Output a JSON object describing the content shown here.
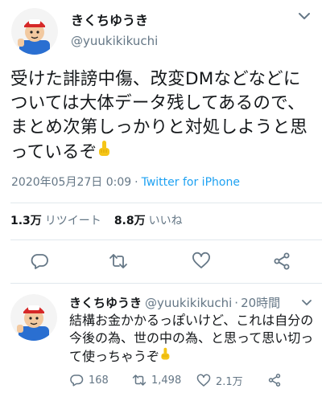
{
  "main_tweet": {
    "author_name": "きくちゆうき",
    "author_handle": "@yuukikikuchi",
    "text": "受けた誹謗中傷、改変DMなどなどについては大体データ残してあるので、まとめ次第しっかりと対処しようと思っているぞ",
    "emoji": "☝",
    "timestamp": "2020年05月27日 0:09",
    "separator": "·",
    "source": "Twitter for iPhone",
    "retweet_count": "1.3万",
    "retweet_label": "リツイート",
    "like_count": "8.8万",
    "like_label": "いいね"
  },
  "reply_tweet": {
    "author_name": "きくちゆうき",
    "author_handle": "@yuukikikuchi",
    "separator": "·",
    "time": "20時間",
    "text": "結構お金かかるっぽいけど、これは自分の今後の為、世の中の為、と思って思い切って使っちゃうぞ",
    "emoji": "☝",
    "reply_count": "168",
    "retweet_count": "1,498",
    "like_count": "2.1万"
  },
  "icons": [
    "chevron-down-icon",
    "reply-icon",
    "retweet-icon",
    "like-icon",
    "share-icon",
    "pointing-up-emoji"
  ],
  "colors": {
    "text": "#14171a",
    "secondary": "#657786",
    "link": "#1da1f2",
    "divider": "#e1e8ed",
    "icon": "#657786",
    "emoji": "#f5c518"
  }
}
